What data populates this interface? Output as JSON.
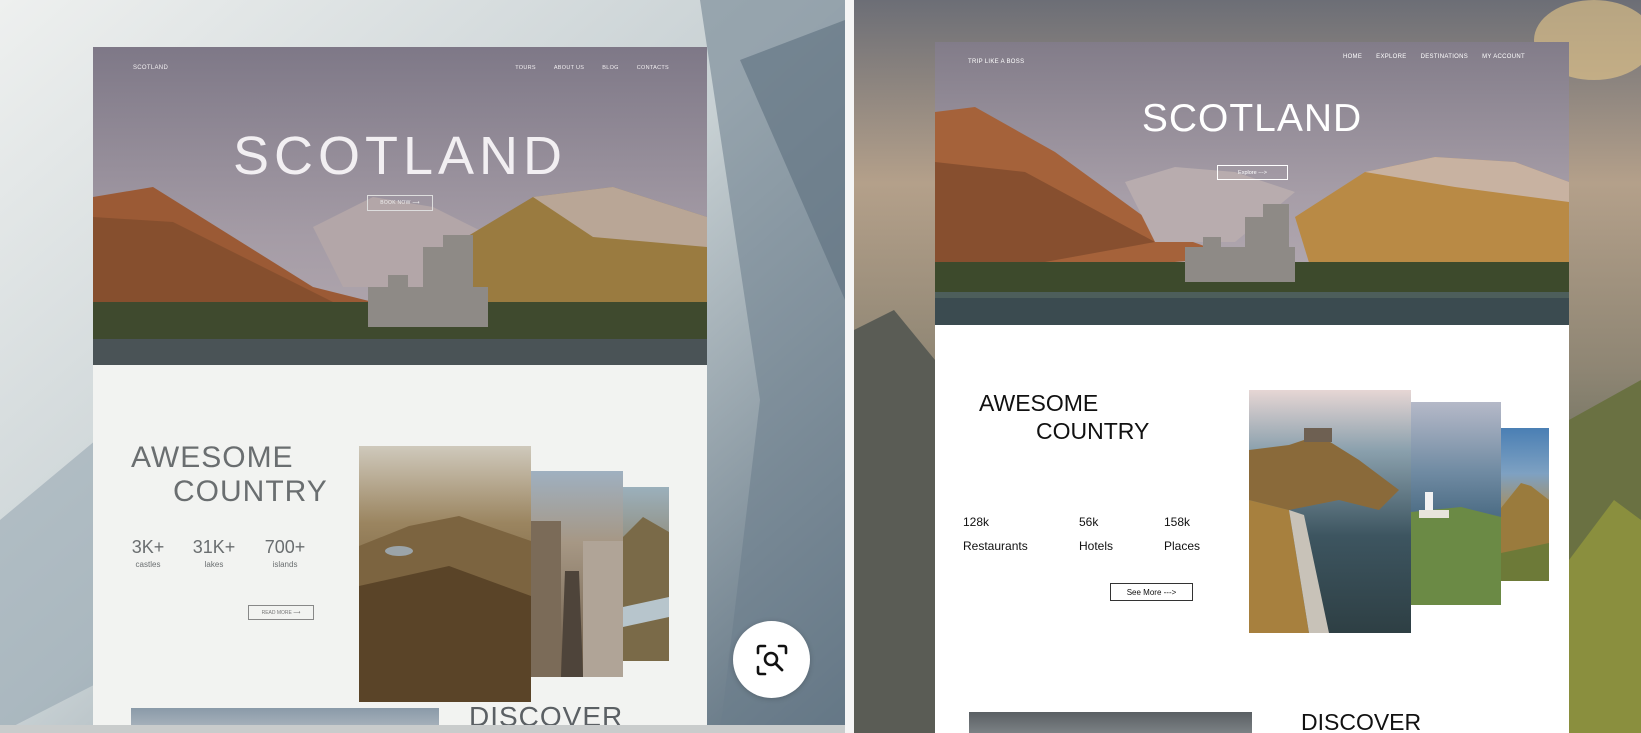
{
  "left_mockup": {
    "brand": "SCOTLAND",
    "nav": [
      "TOURS",
      "ABOUT US",
      "BLOG",
      "CONTACTS"
    ],
    "hero_title": "SCOTLAND",
    "book_button": "BOOK NOW  ⟶",
    "heading_line1": "AWESOME",
    "heading_line2": "COUNTRY",
    "stats": [
      {
        "value": "3K+",
        "label": "castles"
      },
      {
        "value": "31K+",
        "label": "lakes"
      },
      {
        "value": "700+",
        "label": "islands"
      }
    ],
    "read_more": "READ MORE  ⟶",
    "discover": "DISCOVER"
  },
  "lens_button": {
    "icon": "image-search-icon"
  },
  "right_site": {
    "brand": "TRIP LIKE A BOSS",
    "nav": [
      "HOME",
      "EXPLORE",
      "DESTINATIONS",
      "MY ACCOUNT"
    ],
    "hero_title": "SCOTLAND",
    "explore_button": "Explore --->",
    "heading_line1": "AWESOME",
    "heading_line2": "COUNTRY",
    "stats": [
      {
        "value": "128k",
        "label": "Restaurants"
      },
      {
        "value": "56k",
        "label": "Hotels"
      },
      {
        "value": "158k",
        "label": "Places"
      }
    ],
    "see_more": "See More --->",
    "discover": "DISCOVER"
  },
  "colors": {
    "hero_sky": "#8f8a96",
    "mountain_rust": "#a5623a",
    "mountain_gold": "#b98a45",
    "water": "#3b4b50",
    "mockup_text": "#6a6e70"
  }
}
